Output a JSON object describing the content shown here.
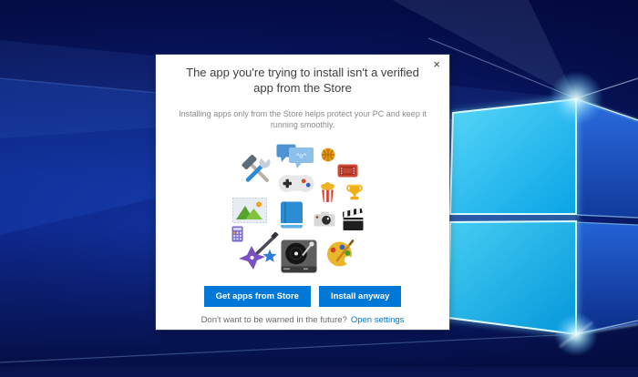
{
  "window": {
    "close_icon": "×"
  },
  "dialog": {
    "title_line1": "The app you're trying to install isn't a verified",
    "title_line2": "app from the Store",
    "subtitle_line1": "Installing apps only from the Store helps protect your PC and keep it",
    "subtitle_line2": "running smoothly.",
    "chat_emoticon": "^o^",
    "icons": [
      "tools",
      "chat-bubbles",
      "basketball",
      "ticket",
      "game-controller",
      "popcorn",
      "trophy",
      "picture",
      "book",
      "camera",
      "clapperboard",
      "calculator",
      "guitar",
      "star",
      "turntable",
      "palette"
    ],
    "buttons": {
      "get_apps": "Get apps from Store",
      "install_anyway": "Install anyway"
    },
    "footer": {
      "question": "Don't want to be warned in the future?",
      "link": "Open settings"
    }
  },
  "colors": {
    "accent_blue": "#0078d7",
    "link_blue": "#0078d7",
    "title_text": "#3f3f3f",
    "subtitle_text": "#8a8a8a",
    "dialog_bg": "#ffffff",
    "wallpaper_navy": "#0c2385",
    "logo_cyan": "#1fbdf0"
  }
}
